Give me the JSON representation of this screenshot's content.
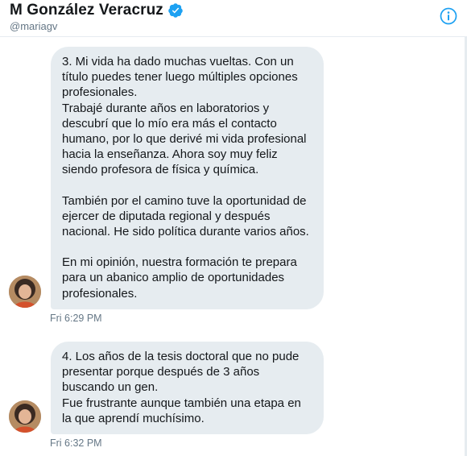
{
  "header": {
    "name": "M González Veracruz",
    "handle": "@mariagv"
  },
  "messages": [
    {
      "paragraphs": [
        "3. Mi vida ha dado muchas vueltas. Con un título puedes tener luego múltiples opciones profesionales.",
        "Trabajé durante años en laboratorios y descubrí que lo mío era más el contacto humano, por lo que derivé mi vida profesional hacia la enseñanza. Ahora soy muy feliz siendo profesora de física y química.",
        "También por el camino tuve la oportunidad de ejercer de diputada regional y después nacional. He sido política durante varios años.",
        "En mi opinión, nuestra formación te prepara para un abanico amplio de oportunidades profesionales."
      ],
      "timestamp": "Fri 6:29 PM"
    },
    {
      "paragraphs": [
        "4. Los años de la tesis doctoral que no pude presentar porque después de 3 años buscando un gen.",
        "Fue frustrante aunque también una etapa en la que aprendí muchísimo."
      ],
      "timestamp": "Fri 6:32 PM"
    }
  ],
  "icons": {
    "verified": "verified-badge-icon",
    "info": "info-icon"
  },
  "colors": {
    "accent": "#1da1f2",
    "bubble": "#e6ecf0",
    "secondary_text": "#657786"
  }
}
